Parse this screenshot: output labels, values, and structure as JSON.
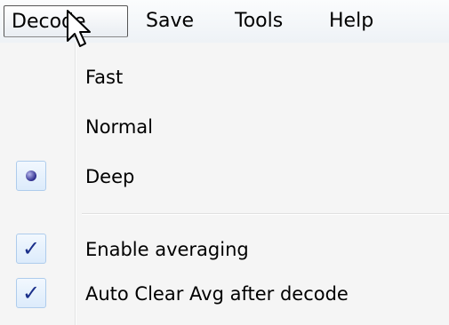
{
  "menubar": {
    "items": [
      {
        "label": "Decode"
      },
      {
        "label": "Save"
      },
      {
        "label": "Tools"
      },
      {
        "label": "Help"
      }
    ]
  },
  "dropdown": {
    "items": [
      {
        "label": "Fast",
        "state": "none"
      },
      {
        "label": "Normal",
        "state": "none"
      },
      {
        "label": "Deep",
        "state": "radio-selected"
      },
      {
        "label": "Enable averaging",
        "state": "checked"
      },
      {
        "label": "Auto Clear Avg after decode",
        "state": "checked"
      }
    ]
  },
  "icons": {
    "cursor": "arrow-pointer-icon",
    "radio": "radio-dot-icon",
    "check": "checkmark-icon"
  }
}
